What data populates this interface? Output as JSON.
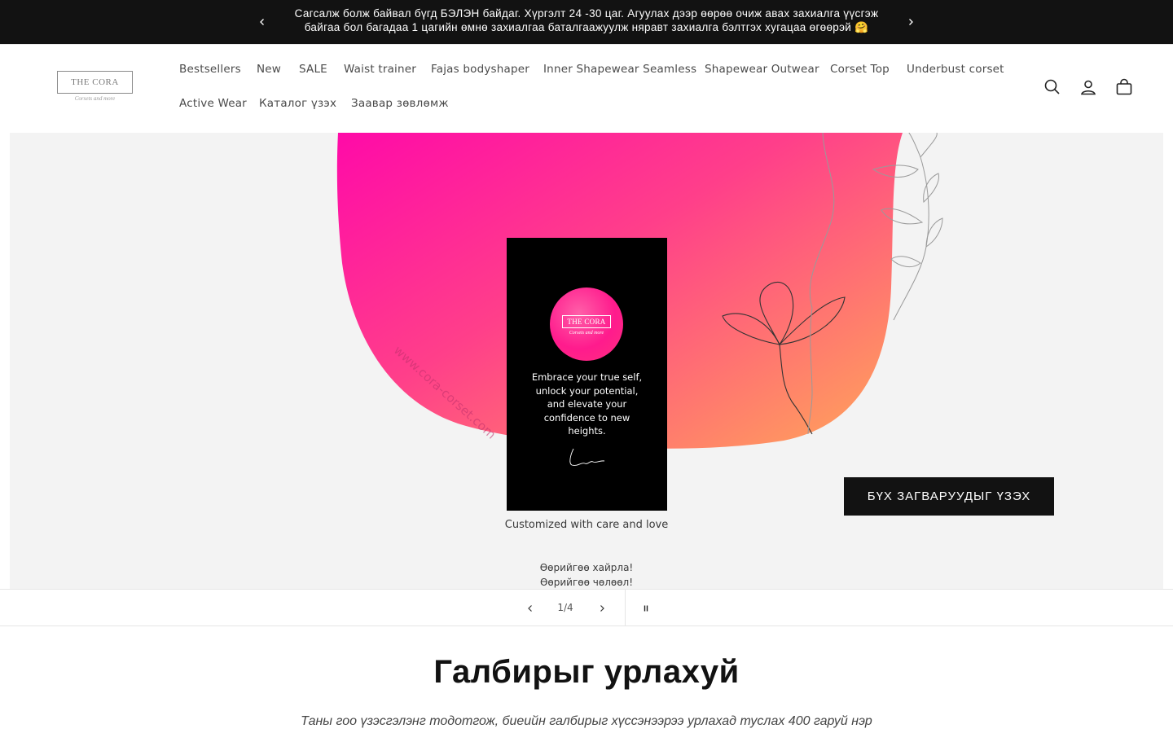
{
  "announcement": {
    "message_line1": "Сагсалж болж байвал бүгд БЭЛЭН байдаг. Хүргэлт 24 -30 цаг. Агуулах дээр өөрөө очиж авах захиалга үүсгэж",
    "message_line2": "байгаа бол багадаа 1 цагийн өмнө захиалгаа баталгаажуулж няравт захиалга бэлтгэх хугацаа өгөөрэй 🤗",
    "prev_icon": "chevron-left-icon",
    "next_icon": "chevron-right-icon"
  },
  "header": {
    "logo_text": "THE CORA",
    "logo_tagline": "Corsets and more",
    "nav": [
      "Bestsellers",
      "New",
      "SALE",
      "Waist trainer",
      "Fajas bodyshaper",
      "Inner Shapewear Seamless",
      "Shapewear Outwear",
      "Corset Top",
      "Underbust corset",
      "Active Wear",
      "Каталог үзэх",
      "Заавар зөвлөмж"
    ],
    "icons": [
      "search-icon",
      "account-icon",
      "cart-icon"
    ]
  },
  "hero": {
    "watermark": "www.cora-corset.com",
    "card_logo": "THE CORA",
    "card_tagline": "Corsets and more",
    "card_quote": "Embrace your true self, unlock your potential, and elevate your confidence to new heights.",
    "card_signature": "Love",
    "caption": "Customized with care and love",
    "slogan_line1": "Өөрийгөө хайрла!",
    "slogan_line2": "Өөрийгөө чөлөөл!",
    "cta_label": "БҮХ ЗАГВАРУУДЫГ ҮЗЭХ",
    "colors": {
      "pink": "#ff0fa0",
      "orange": "#ff9a5e",
      "background": "#f3f3f3"
    }
  },
  "slider": {
    "counter": "1/4",
    "prev_icon": "chevron-left-icon",
    "next_icon": "chevron-right-icon",
    "pause_icon": "pause-icon"
  },
  "section": {
    "title": "Галбирыг урлахуй",
    "text": "Таны гоо үзэсгэлэнг тодотгож, биеийн галбирыг хүссэнээрээ урлахад туслах 400 гаруй нэр"
  }
}
